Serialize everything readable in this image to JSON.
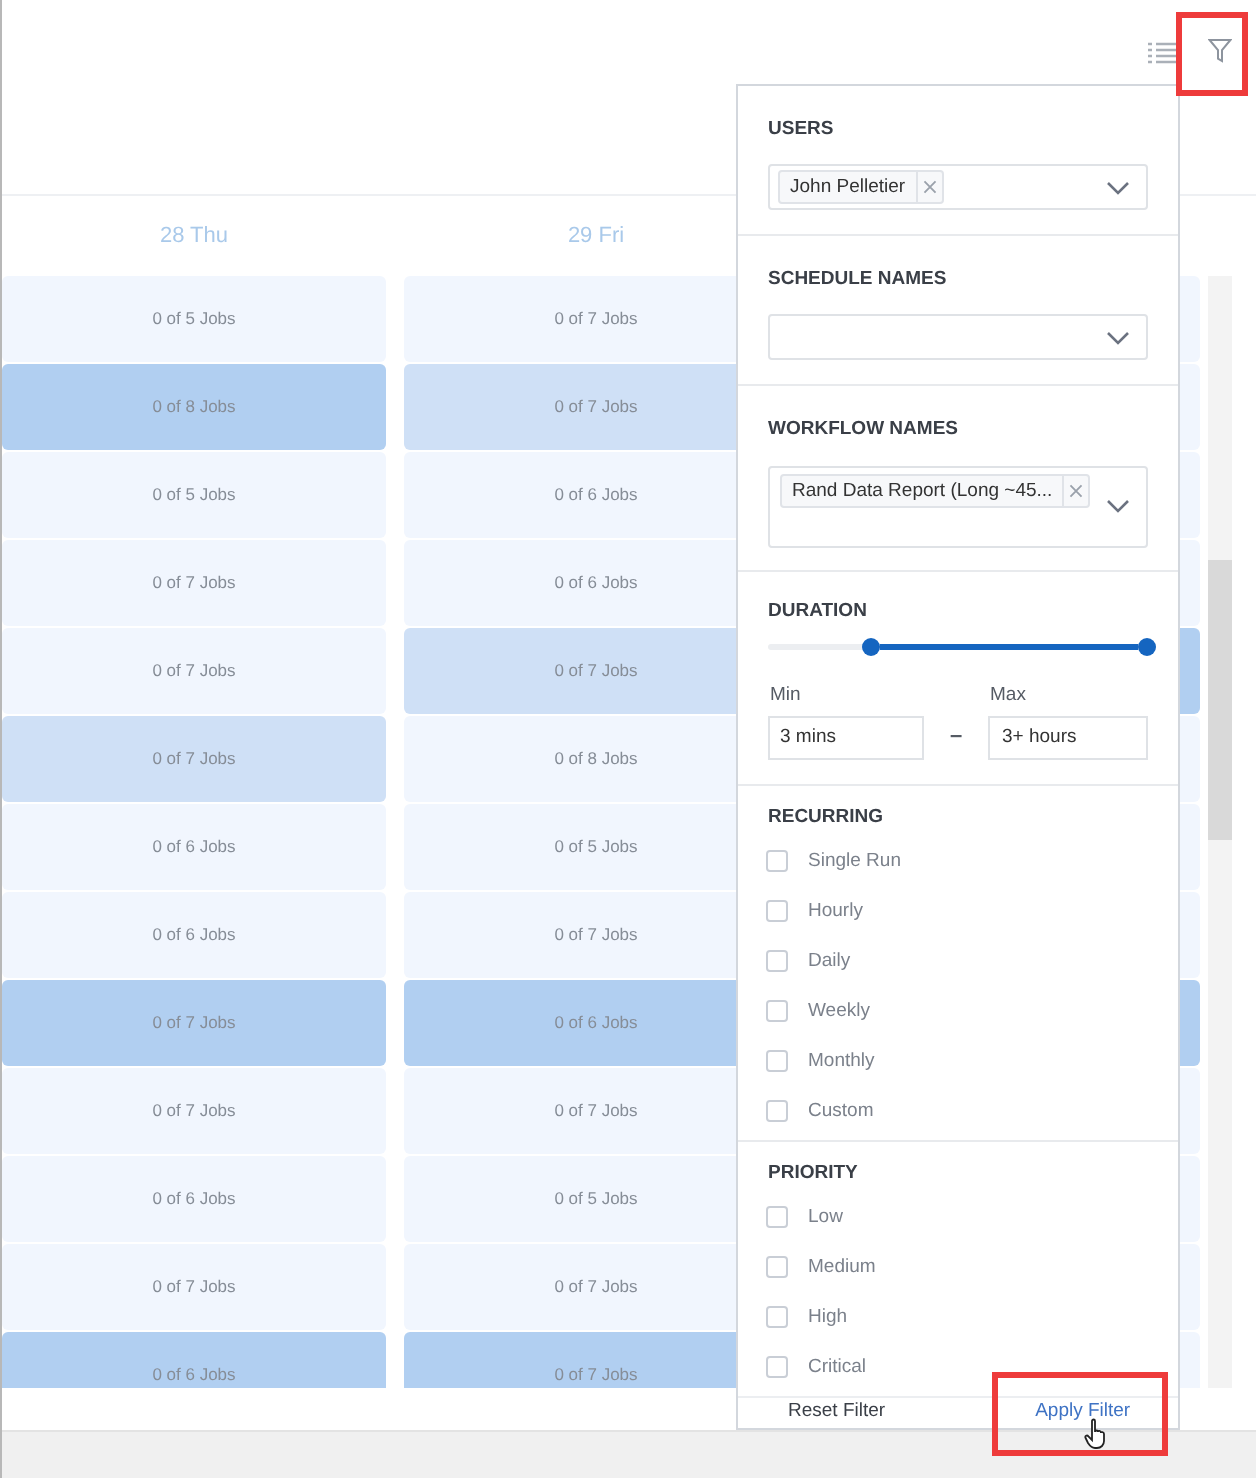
{
  "days": [
    {
      "label": "28 Thu"
    },
    {
      "label": "29 Fri"
    }
  ],
  "columns": [
    {
      "cells": [
        {
          "text": "0 of 5 Jobs",
          "color": "#f1f6fe"
        },
        {
          "text": "0 of 8 Jobs",
          "color": "#b1cff1"
        },
        {
          "text": "0 of 5 Jobs",
          "color": "#f1f6fe"
        },
        {
          "text": "0 of 7 Jobs",
          "color": "#f1f6fe"
        },
        {
          "text": "0 of 7 Jobs",
          "color": "#f1f6fe"
        },
        {
          "text": "0 of 7 Jobs",
          "color": "#cfe0f6"
        },
        {
          "text": "0 of 6 Jobs",
          "color": "#f1f6fe"
        },
        {
          "text": "0 of 6 Jobs",
          "color": "#f1f6fe"
        },
        {
          "text": "0 of 7 Jobs",
          "color": "#b1cff1"
        },
        {
          "text": "0 of 7 Jobs",
          "color": "#f1f6fe"
        },
        {
          "text": "0 of 6 Jobs",
          "color": "#f1f6fe"
        },
        {
          "text": "0 of 7 Jobs",
          "color": "#f1f6fe"
        },
        {
          "text": "0 of 6 Jobs",
          "color": "#b1cff1"
        }
      ]
    },
    {
      "cells": [
        {
          "text": "0 of 7 Jobs",
          "color": "#f1f6fe"
        },
        {
          "text": "0 of 7 Jobs",
          "color": "#cfe0f6"
        },
        {
          "text": "0 of 6 Jobs",
          "color": "#f1f6fe"
        },
        {
          "text": "0 of 6 Jobs",
          "color": "#f1f6fe"
        },
        {
          "text": "0 of 7 Jobs",
          "color": "#cfe0f6"
        },
        {
          "text": "0 of 8 Jobs",
          "color": "#f1f6fe"
        },
        {
          "text": "0 of 5 Jobs",
          "color": "#f1f6fe"
        },
        {
          "text": "0 of 7 Jobs",
          "color": "#f1f6fe"
        },
        {
          "text": "0 of 6 Jobs",
          "color": "#b1cff1"
        },
        {
          "text": "0 of 7 Jobs",
          "color": "#f1f6fe"
        },
        {
          "text": "0 of 5 Jobs",
          "color": "#f1f6fe"
        },
        {
          "text": "0 of 7 Jobs",
          "color": "#f1f6fe"
        },
        {
          "text": "0 of 7 Jobs",
          "color": "#b1cff1"
        }
      ]
    },
    {
      "cells": [
        {
          "color": "#f1f6fe"
        },
        {
          "color": "#f1f6fe"
        },
        {
          "color": "#f1f6fe"
        },
        {
          "color": "#f1f6fe"
        },
        {
          "color": "#b1cff1"
        },
        {
          "color": "#f1f6fe"
        },
        {
          "color": "#f1f6fe"
        },
        {
          "color": "#f1f6fe"
        },
        {
          "color": "#b1cff1"
        },
        {
          "color": "#f1f6fe"
        },
        {
          "color": "#f1f6fe"
        },
        {
          "color": "#f1f6fe"
        },
        {
          "color": "#f1f6fe"
        }
      ]
    }
  ],
  "filter_panel": {
    "users": {
      "label": "USERS",
      "tags": [
        "John Pelletier"
      ]
    },
    "schedule_names": {
      "label": "SCHEDULE NAMES"
    },
    "workflow_names": {
      "label": "WORKFLOW NAMES",
      "tags": [
        "Rand Data Report (Long ~45..."
      ]
    },
    "duration": {
      "label": "DURATION",
      "level": 0.73,
      "min_label": "Min",
      "min_value": "3 mins",
      "separator": "–",
      "max_label": "Max",
      "max_value": "3+ hours"
    },
    "recurring": {
      "label": "RECURRING",
      "items": [
        {
          "label": "Single Run",
          "checked": false
        },
        {
          "label": "Hourly",
          "checked": false
        },
        {
          "label": "Daily",
          "checked": false
        },
        {
          "label": "Weekly",
          "checked": false
        },
        {
          "label": "Monthly",
          "checked": false
        },
        {
          "label": "Custom",
          "checked": false
        }
      ]
    },
    "priority": {
      "label": "PRIORITY",
      "items": [
        {
          "label": "Low",
          "checked": false
        },
        {
          "label": "Medium",
          "checked": false
        },
        {
          "label": "High",
          "checked": false
        },
        {
          "label": "Critical",
          "checked": false
        }
      ]
    },
    "reset_label": "Reset Filter",
    "apply_label": "Apply Filter"
  }
}
